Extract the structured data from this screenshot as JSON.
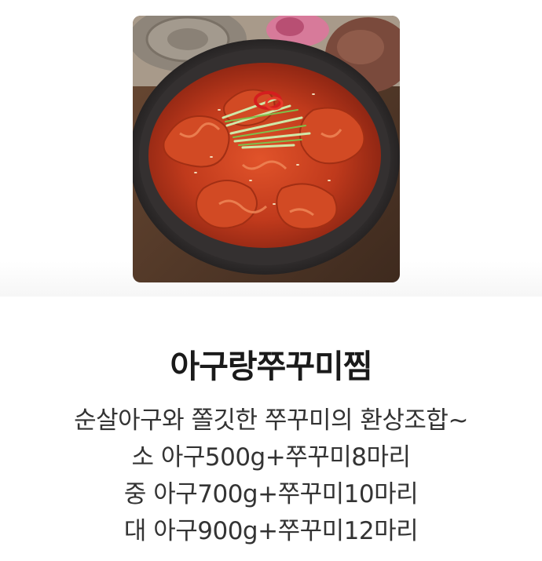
{
  "menu": {
    "image_name": "menu-photo",
    "title": "아구랑쭈꾸미찜",
    "description": [
      "순살아구와 쫄깃한 쭈꾸미의 환상조합~",
      "소 아구500g+쭈꾸미8마리",
      "중 아구700g+쭈꾸미10마리",
      "대 아구900g+쭈꾸미12마리"
    ]
  }
}
